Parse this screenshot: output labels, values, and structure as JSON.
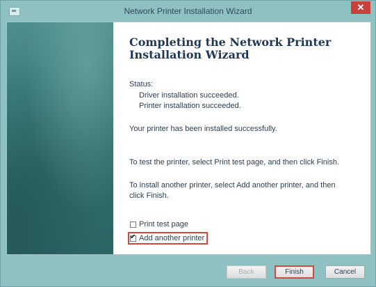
{
  "window": {
    "title": "Network Printer Installation Wizard",
    "close_label": "✕"
  },
  "main": {
    "heading_line1": "Completing the Network Printer",
    "heading_line2": "Installation Wizard",
    "status_label": "Status:",
    "status_items": [
      "Driver installation succeeded.",
      "Printer installation succeeded."
    ],
    "installed_message": "Your printer has been installed successfully.",
    "test_instruction": "To test the printer, select Print test page, and then click Finish.",
    "another_instruction": "To install another printer, select Add another printer, and then click Finish.",
    "options": [
      {
        "label": "Print test page",
        "checked": false
      },
      {
        "label": "Add another printer",
        "checked": true
      }
    ]
  },
  "footer": {
    "back_label": "Back",
    "finish_label": "Finish",
    "cancel_label": "Cancel"
  },
  "colors": {
    "frame": "#8fc1c2",
    "banner": "#3d7d7c",
    "heading": "#1f3756",
    "highlight": "#d24a3c",
    "close": "#c8403a"
  }
}
